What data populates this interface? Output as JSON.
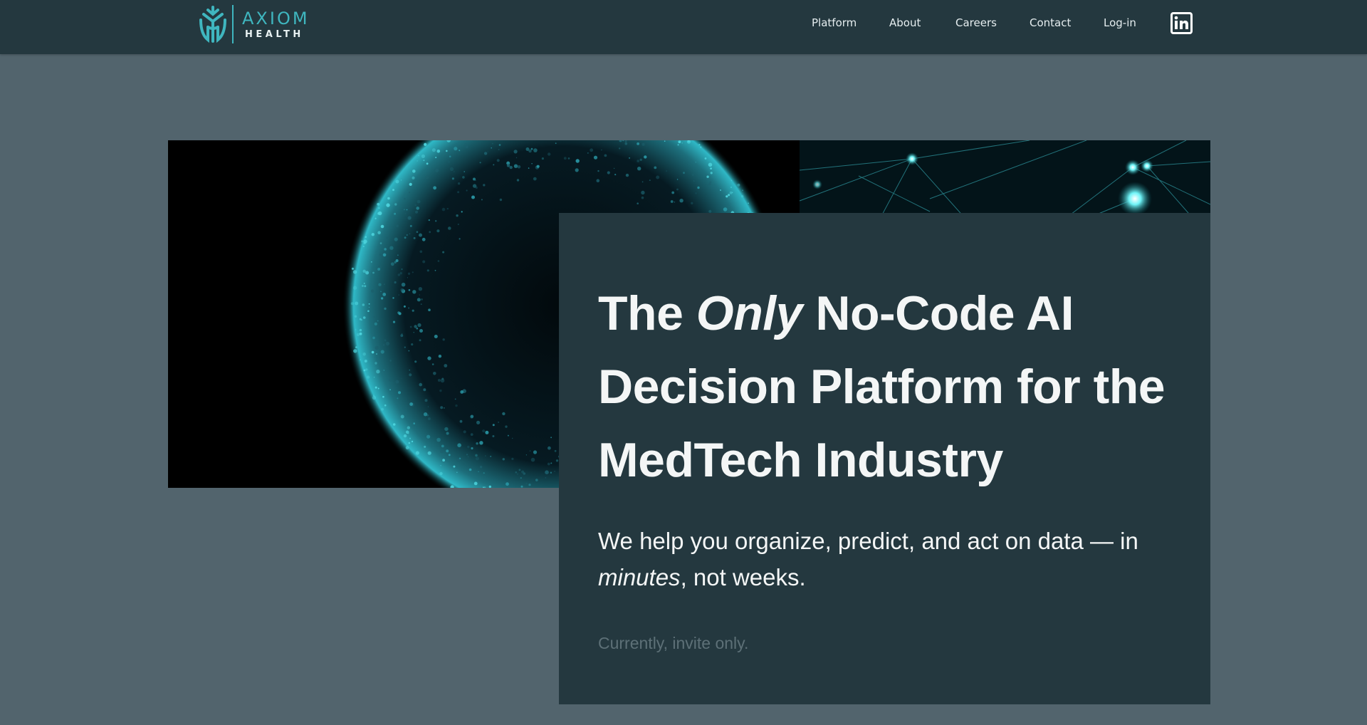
{
  "brand": {
    "word1": "AXIOM",
    "word2": "HEALTH",
    "accent_color": "#3fb6bf",
    "icon": "axiom-tree-logo"
  },
  "nav": {
    "items": [
      {
        "label": "Platform"
      },
      {
        "label": "About"
      },
      {
        "label": "Careers"
      },
      {
        "label": "Contact"
      },
      {
        "label": "Log-in"
      }
    ],
    "social_icon": "linkedin-icon"
  },
  "hero": {
    "image": "particle-globe-network",
    "headline": {
      "part1": "The ",
      "emphasis": "Only",
      "part2": " No-Code AI Decision Platform for the MedTech Industry"
    },
    "subheadline": {
      "part1": "We help you organize, predict, and act on data — in ",
      "emphasis": "minutes",
      "part2": ", not weeks."
    },
    "note": "Currently, invite only."
  },
  "colors": {
    "page_background": "#52646d",
    "header_background": "#24383f",
    "card_background": "#24383f",
    "text_primary": "#f4f6f6",
    "text_muted": "#5d7077"
  }
}
